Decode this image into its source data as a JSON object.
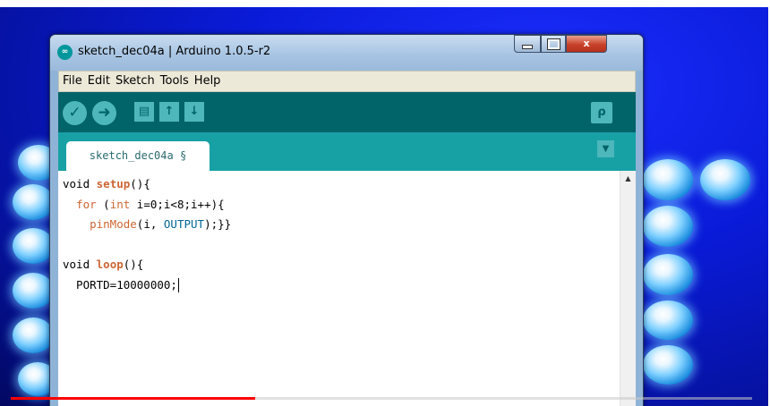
{
  "window": {
    "title": "sketch_dec04a | Arduino 1.0.5-r2",
    "app_icon_text": "∞"
  },
  "titlebar_buttons": {
    "minimize": "minimize",
    "maximize": "maximize",
    "close": "x"
  },
  "menubar": {
    "items": [
      "File",
      "Edit",
      "Sketch",
      "Tools",
      "Help"
    ]
  },
  "toolbar": {
    "verify_icon": "✓",
    "upload_icon": "➜",
    "new_icon": "▤",
    "open_icon": "↑",
    "save_icon": "↓",
    "serial_monitor_icon": "ρ"
  },
  "tabs": [
    {
      "label": "sketch_dec04a",
      "modified_mark": "§"
    }
  ],
  "tab_menu_icon": "▼",
  "code": {
    "line1": {
      "t1": "void ",
      "fn": "setup",
      "t2": "(){"
    },
    "line2": {
      "t1": "  ",
      "kw": "for",
      "t2": " (",
      "kw2": "int",
      "t3": " i=0;i<8;i++){"
    },
    "line3": {
      "t1": "    ",
      "fn": "pinMode",
      "t2": "(i, ",
      "const": "OUTPUT",
      "t3": ");}}"
    },
    "line4": "",
    "line5": {
      "t1": "void ",
      "fn": "loop",
      "t2": "(){"
    },
    "line6": {
      "t1": "  PORTD=10000000;"
    }
  },
  "video_progress": 0.33,
  "colors": {
    "toolbar": "#006468",
    "tabbar": "#17a1a5",
    "button": "#4db7bb",
    "keyword": "#cc6633",
    "constant": "#006699",
    "progress": "#ff0000"
  }
}
